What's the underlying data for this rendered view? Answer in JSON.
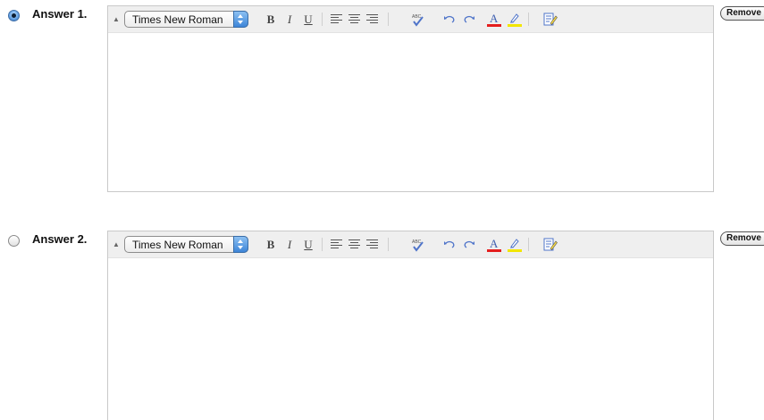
{
  "answers": [
    {
      "label": "Answer 1.",
      "selected": true,
      "font": "Times New Roman",
      "remove_label": "Remove"
    },
    {
      "label": "Answer 2.",
      "selected": false,
      "font": "Times New Roman",
      "remove_label": "Remove"
    }
  ],
  "toolbar": {
    "bold": "B",
    "italic": "I",
    "underline": "U",
    "spell_label": "ABC",
    "font_color_letter": "A",
    "font_color": "#e41e1e",
    "highlight_color": "#f2e600"
  },
  "colors": {
    "radio_selected": "#3f7fd0",
    "editor_border": "#c9c9c9",
    "toolbar_bg": "#efefef"
  }
}
